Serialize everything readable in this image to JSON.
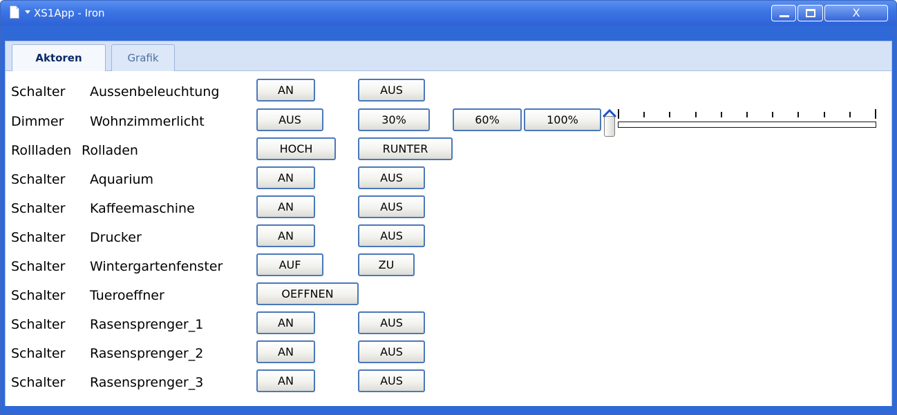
{
  "window": {
    "title": "XS1App - Iron",
    "controls": {
      "close_symbol": "X"
    }
  },
  "tabs": [
    {
      "label": "Aktoren",
      "selected": true
    },
    {
      "label": "Grafik",
      "selected": false
    }
  ],
  "rows": [
    {
      "type": "Schalter",
      "name": "Aussenbeleuchtung",
      "buttons": [
        "AN",
        "AUS"
      ]
    },
    {
      "type": "Dimmer",
      "name": "Wohnzimmerlicht",
      "buttons": [
        "AUS",
        "30%",
        "60%",
        "100%"
      ]
    },
    {
      "type": "Rollladen",
      "name": "Rolladen",
      "buttons": [
        "HOCH",
        "RUNTER"
      ]
    },
    {
      "type": "Schalter",
      "name": "Aquarium",
      "buttons": [
        "AN",
        "AUS"
      ]
    },
    {
      "type": "Schalter",
      "name": "Kaffeemaschine",
      "buttons": [
        "AN",
        "AUS"
      ]
    },
    {
      "type": "Schalter",
      "name": "Drucker",
      "buttons": [
        "AN",
        "AUS"
      ]
    },
    {
      "type": "Schalter",
      "name": "Wintergartenfenster",
      "buttons": [
        "AUF",
        "ZU"
      ]
    },
    {
      "type": "Schalter",
      "name": "Tueroeffner",
      "buttons": [
        "OEFFNEN"
      ]
    },
    {
      "type": "Schalter",
      "name": "Rasensprenger_1",
      "buttons": [
        "AN",
        "AUS"
      ]
    },
    {
      "type": "Schalter",
      "name": "Rasensprenger_2",
      "buttons": [
        "AN",
        "AUS"
      ]
    },
    {
      "type": "Schalter",
      "name": "Rasensprenger_3",
      "buttons": [
        "AN",
        "AUS"
      ]
    }
  ],
  "dimmer_slider": {
    "value": 0,
    "min": 0,
    "max": 100,
    "tick_count": 11
  },
  "colors": {
    "titlebar": "#2e62d6",
    "tabbar": "#d6e3f7",
    "button_border": "#4a78b8",
    "active_tab_text": "#0a2b66"
  },
  "icons": [
    "document-icon",
    "dropdown-caret-icon",
    "minimize-icon",
    "maximize-icon",
    "close-icon",
    "slider-thumb-icon"
  ]
}
